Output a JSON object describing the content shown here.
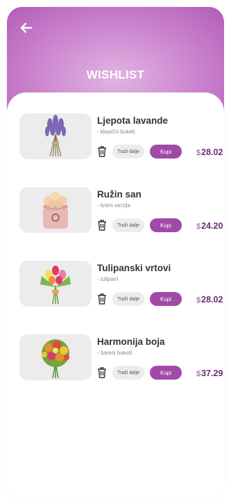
{
  "header": {
    "title": "WISHLIST"
  },
  "actions": {
    "find_label": "Traži dalje",
    "buy_label": "Kupi",
    "currency": "$"
  },
  "items": [
    {
      "name": "Ljepota lavande",
      "category": "- klasični buketi",
      "price": "28.02"
    },
    {
      "name": "Ružin san",
      "category": "- krem verzija",
      "price": "24.20"
    },
    {
      "name": "Tulipanski vrtovi",
      "category": "- tulipani",
      "price": "28.02"
    },
    {
      "name": "Harmonija boja",
      "category": "- šareni buketi",
      "price": "37.29"
    }
  ],
  "colors": {
    "accent": "#a04aa7",
    "price": "#6d2a74",
    "header_top": "#cf8bd2"
  }
}
